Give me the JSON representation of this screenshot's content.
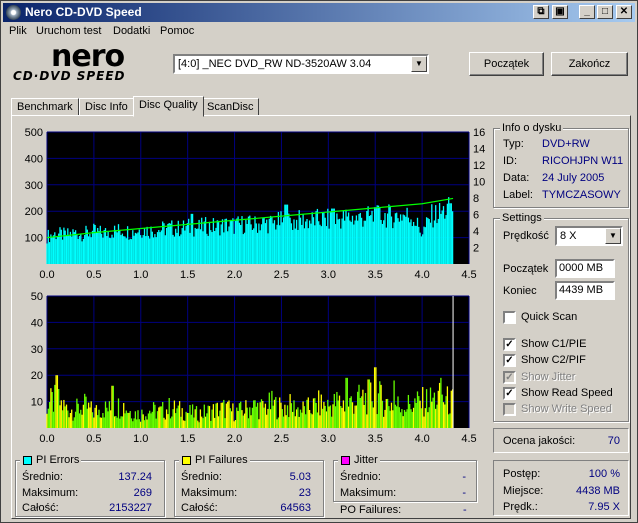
{
  "window": {
    "title": "Nero CD-DVD Speed",
    "colors": {
      "title_start": "#0a246a",
      "title_end": "#a6caf0",
      "face": "#d4d0c8",
      "value_text": "#000080"
    }
  },
  "menu": {
    "items": [
      "Plik",
      "Uruchom test",
      "Dodatki",
      "Pomoc"
    ]
  },
  "logo": {
    "name": "nero",
    "subtitle": "CD·DVD SPEED"
  },
  "drive": {
    "selected": "[4:0]  _NEC DVD_RW ND-3520AW 3.04"
  },
  "buttons": {
    "start": "Początek",
    "stop": "Zakończ"
  },
  "tabs": [
    {
      "label": "Benchmark",
      "active": false
    },
    {
      "label": "Disc Info",
      "active": false
    },
    {
      "label": "Disc Quality",
      "active": true
    },
    {
      "label": "ScanDisc",
      "active": false
    }
  ],
  "disc_info": {
    "title": "Info o dysku",
    "rows": [
      {
        "label": "Typ:",
        "value": "DVD+RW"
      },
      {
        "label": "ID:",
        "value": "RICOHJPN W11"
      },
      {
        "label": "Data:",
        "value": "24 July 2005"
      },
      {
        "label": "Label:",
        "value": "TYMCZASOWY"
      }
    ]
  },
  "settings": {
    "title": "Settings",
    "speed_label": "Prędkość",
    "speed_value": "8 X",
    "start_label": "Początek",
    "start_value": "0000 MB",
    "end_label": "Koniec",
    "end_value": "4439 MB",
    "checkboxes": [
      {
        "label": "Quick Scan",
        "checked": false,
        "disabled": false
      },
      {
        "label": "Show C1/PIE",
        "checked": true,
        "disabled": false
      },
      {
        "label": "Show C2/PIF",
        "checked": true,
        "disabled": false
      },
      {
        "label": "Show Jitter",
        "checked": true,
        "disabled": true
      },
      {
        "label": "Show Read Speed",
        "checked": true,
        "disabled": false
      },
      {
        "label": "Show Write Speed",
        "checked": false,
        "disabled": true
      }
    ]
  },
  "quality": {
    "label": "Ocena jakości:",
    "value": "70"
  },
  "progress": {
    "rows": [
      {
        "label": "Postęp:",
        "value": "100 %"
      },
      {
        "label": "Miejsce:",
        "value": "4438 MB"
      },
      {
        "label": "Prędk.:",
        "value": "7.95 X"
      }
    ]
  },
  "pi_errors": {
    "title": "PI Errors",
    "color": "#00ffff",
    "rows": [
      {
        "label": "Średnio:",
        "value": "137.24"
      },
      {
        "label": "Maksimum:",
        "value": "269"
      },
      {
        "label": "Całość:",
        "value": "2153227"
      }
    ]
  },
  "pi_failures": {
    "title": "PI Failures",
    "color": "#ffff00",
    "rows": [
      {
        "label": "Średnio:",
        "value": "5.03"
      },
      {
        "label": "Maksimum:",
        "value": "23"
      },
      {
        "label": "Całość:",
        "value": "64563"
      }
    ]
  },
  "jitter": {
    "title": "Jitter",
    "color": "#ff00ff",
    "rows": [
      {
        "label": "Średnio:",
        "value": "-"
      },
      {
        "label": "Maksimum:",
        "value": "-"
      }
    ],
    "po_label": "PO Failures:",
    "po_value": "-"
  },
  "chart_data": [
    {
      "type": "area",
      "title": "",
      "xlabel": "",
      "ylabel": "",
      "x_ticks": [
        "0.0",
        "0.5",
        "1.0",
        "1.5",
        "2.0",
        "2.5",
        "3.0",
        "3.5",
        "4.0",
        "4.5"
      ],
      "y_ticks": [
        "100",
        "200",
        "300",
        "400",
        "500"
      ],
      "y2_ticks": [
        "2",
        "4",
        "6",
        "8",
        "10",
        "12",
        "14",
        "16"
      ],
      "xlim": [
        0,
        4.5
      ],
      "ylim": [
        0,
        500
      ],
      "y2lim": [
        0,
        16
      ],
      "grid": true,
      "series": [
        {
          "name": "PI Errors",
          "color": "#00ffff",
          "x": [
            0.0,
            0.1,
            0.2,
            0.3,
            0.4,
            0.5,
            0.6,
            0.7,
            0.8,
            0.9,
            1.0,
            1.1,
            1.2,
            1.3,
            1.4,
            1.5,
            1.6,
            1.7,
            1.8,
            1.9,
            2.0,
            2.1,
            2.2,
            2.3,
            2.4,
            2.5,
            2.6,
            2.7,
            2.8,
            2.9,
            3.0,
            3.1,
            3.2,
            3.3,
            3.4,
            3.5,
            3.6,
            3.7,
            3.8,
            3.9,
            4.0,
            4.1,
            4.2,
            4.3
          ],
          "y": [
            108,
            118,
            112,
            122,
            118,
            126,
            120,
            128,
            132,
            124,
            136,
            130,
            134,
            140,
            138,
            144,
            140,
            148,
            146,
            152,
            150,
            156,
            152,
            160,
            158,
            166,
            162,
            170,
            168,
            174,
            172,
            176,
            180,
            178,
            184,
            182,
            188,
            186,
            192,
            184,
            120,
            186,
            200,
            215
          ],
          "spikes": [
            {
              "x": 1.55,
              "y": 190
            },
            {
              "x": 2.55,
              "y": 225
            },
            {
              "x": 3.05,
              "y": 210
            },
            {
              "x": 3.5,
              "y": 215
            },
            {
              "x": 4.3,
              "y": 230
            }
          ]
        },
        {
          "name": "Read Speed",
          "color": "#00ff00",
          "axis": "y2",
          "x": [
            0.0,
            0.5,
            1.0,
            1.5,
            2.0,
            2.5,
            3.0,
            3.5,
            4.0,
            4.33
          ],
          "y": [
            3.2,
            3.8,
            4.3,
            4.8,
            5.3,
            5.8,
            6.3,
            6.8,
            7.3,
            7.95
          ]
        }
      ]
    },
    {
      "type": "bar",
      "title": "",
      "xlabel": "",
      "ylabel": "",
      "x_ticks": [
        "0.0",
        "0.5",
        "1.0",
        "1.5",
        "2.0",
        "2.5",
        "3.0",
        "3.5",
        "4.0",
        "4.5"
      ],
      "y_ticks": [
        "10",
        "20",
        "30",
        "40",
        "50"
      ],
      "xlim": [
        0,
        4.5
      ],
      "ylim": [
        0,
        50
      ],
      "grid": true,
      "series": [
        {
          "name": "PI Failures",
          "color": "#66ff00",
          "x": [
            0.0,
            0.1,
            0.2,
            0.3,
            0.4,
            0.5,
            0.6,
            0.7,
            0.8,
            0.9,
            1.0,
            1.1,
            1.2,
            1.3,
            1.4,
            1.5,
            1.6,
            1.7,
            1.8,
            1.9,
            2.0,
            2.1,
            2.2,
            2.3,
            2.4,
            2.5,
            2.6,
            2.7,
            2.8,
            2.9,
            3.0,
            3.1,
            3.2,
            3.3,
            3.4,
            3.5,
            3.6,
            3.7,
            3.8,
            3.9,
            4.0,
            4.1,
            4.2,
            4.3
          ],
          "y": [
            12,
            14,
            10,
            9,
            11,
            8,
            10,
            9,
            12,
            8,
            7,
            9,
            8,
            10,
            9,
            8,
            7,
            8,
            9,
            10,
            8,
            9,
            11,
            10,
            12,
            10,
            11,
            9,
            10,
            12,
            11,
            13,
            12,
            14,
            15,
            17,
            13,
            12,
            11,
            12,
            13,
            14,
            15,
            13
          ],
          "peaks": [
            {
              "x": 0.1,
              "y": 20
            },
            {
              "x": 0.7,
              "y": 16
            },
            {
              "x": 3.2,
              "y": 19
            },
            {
              "x": 3.5,
              "y": 23
            },
            {
              "x": 3.7,
              "y": 18
            },
            {
              "x": 4.2,
              "y": 19
            }
          ]
        }
      ]
    }
  ]
}
